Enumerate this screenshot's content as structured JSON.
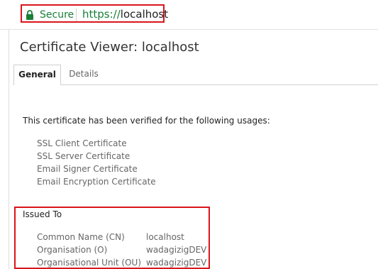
{
  "address_bar": {
    "security_label": "Secure",
    "url_scheme": "https://",
    "url_host": "localhost",
    "security_color": "#188038",
    "highlight_color": "#d9161b",
    "lock_icon": "lock-icon"
  },
  "dialog": {
    "title": "Certificate Viewer: localhost",
    "tabs": [
      {
        "label": "General",
        "selected": true
      },
      {
        "label": "Details",
        "selected": false
      }
    ],
    "usage_heading": "This certificate has been verified for the following usages:",
    "usages": [
      "SSL Client Certificate",
      "SSL Server Certificate",
      "Email Signer Certificate",
      "Email Encryption Certificate"
    ],
    "issued_to": {
      "heading": "Issued To",
      "rows": [
        {
          "label": "Common Name (CN)",
          "value": "localhost"
        },
        {
          "label": "Organisation (O)",
          "value": "wadagizigDEV"
        },
        {
          "label": "Organisational Unit (OU)",
          "value": "wadagizigDEV"
        }
      ]
    }
  }
}
